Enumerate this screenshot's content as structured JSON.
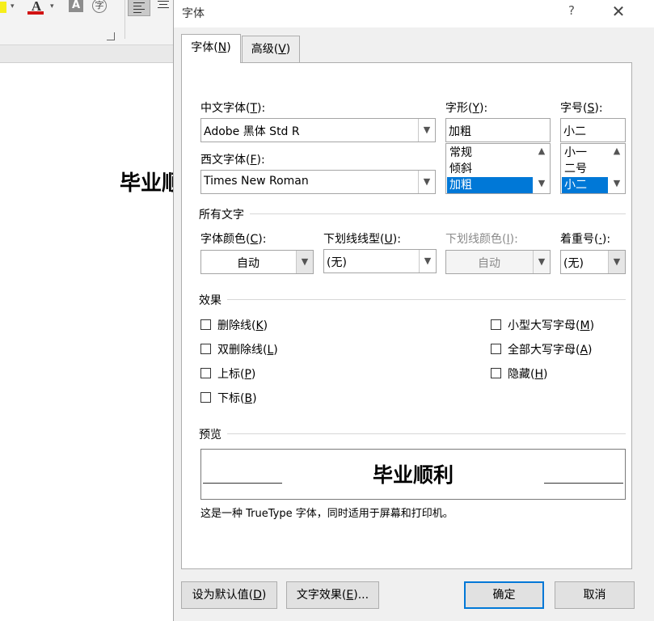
{
  "background": {
    "ribbon": {
      "font_color_glyph": "A",
      "shade_glyph": "A",
      "enclose_glyph": "字",
      "caret": "▾",
      "accent_highlight": "#f6ee1a",
      "accent_font_color": "#d11212"
    },
    "document_text": "毕业顺利"
  },
  "dialog": {
    "title": "字体",
    "help_label": "?",
    "close_label": "✕",
    "tabs": [
      {
        "label": "字体",
        "key": "N",
        "active": true
      },
      {
        "label": "高级",
        "key": "V",
        "active": false
      }
    ],
    "chinese_font": {
      "label": "中文字体",
      "key": "T",
      "suffix": ":",
      "value": "Adobe 黑体 Std R"
    },
    "western_font": {
      "label": "西文字体",
      "key": "F",
      "suffix": ":",
      "value": "Times New Roman"
    },
    "style": {
      "label": "字形",
      "key": "Y",
      "suffix": ":",
      "value": "加粗",
      "options": [
        "常规",
        "倾斜",
        "加粗"
      ],
      "selected": "加粗"
    },
    "size": {
      "label": "字号",
      "key": "S",
      "suffix": ":",
      "value": "小二",
      "options": [
        "小一",
        "二号",
        "小二"
      ],
      "selected": "小二"
    },
    "all_text": {
      "heading": "所有文字",
      "font_color": {
        "label": "字体颜色",
        "key": "C",
        "suffix": ":",
        "value": "自动"
      },
      "underline_style": {
        "label": "下划线线型",
        "key": "U",
        "suffix": ":",
        "value": "(无)"
      },
      "underline_color": {
        "label": "下划线颜色",
        "key": "I",
        "suffix": ":",
        "value": "自动",
        "disabled": true
      },
      "emphasis": {
        "label": "着重号",
        "key": "·",
        "suffix": ":",
        "value": "(无)"
      }
    },
    "effects": {
      "heading": "效果",
      "left": [
        {
          "label": "删除线",
          "key": "K",
          "checked": false
        },
        {
          "label": "双删除线",
          "key": "L",
          "checked": false
        },
        {
          "label": "上标",
          "key": "P",
          "checked": false
        },
        {
          "label": "下标",
          "key": "B",
          "checked": false
        }
      ],
      "right": [
        {
          "label": "小型大写字母",
          "key": "M",
          "checked": false
        },
        {
          "label": "全部大写字母",
          "key": "A",
          "checked": false
        },
        {
          "label": "隐藏",
          "key": "H",
          "checked": false
        }
      ]
    },
    "preview": {
      "heading": "预览",
      "sample_text": "毕业顺利",
      "note": "这是一种 TrueType 字体，同时适用于屏幕和打印机。"
    },
    "buttons": {
      "set_default": {
        "label": "设为默认值",
        "key": "D",
        "suffix": ""
      },
      "text_effects": {
        "label": "文字效果",
        "key": "E",
        "suffix": "..."
      },
      "ok": "确定",
      "cancel": "取消"
    },
    "icons": {
      "dropdown": "chevron-down-icon",
      "scroll_up": "chevron-up-icon",
      "scroll_down": "chevron-down-icon"
    },
    "colors": {
      "selection": "#0078d7",
      "dialog_bg": "#f0f0f0",
      "default_button_border": "#0078d7"
    }
  }
}
